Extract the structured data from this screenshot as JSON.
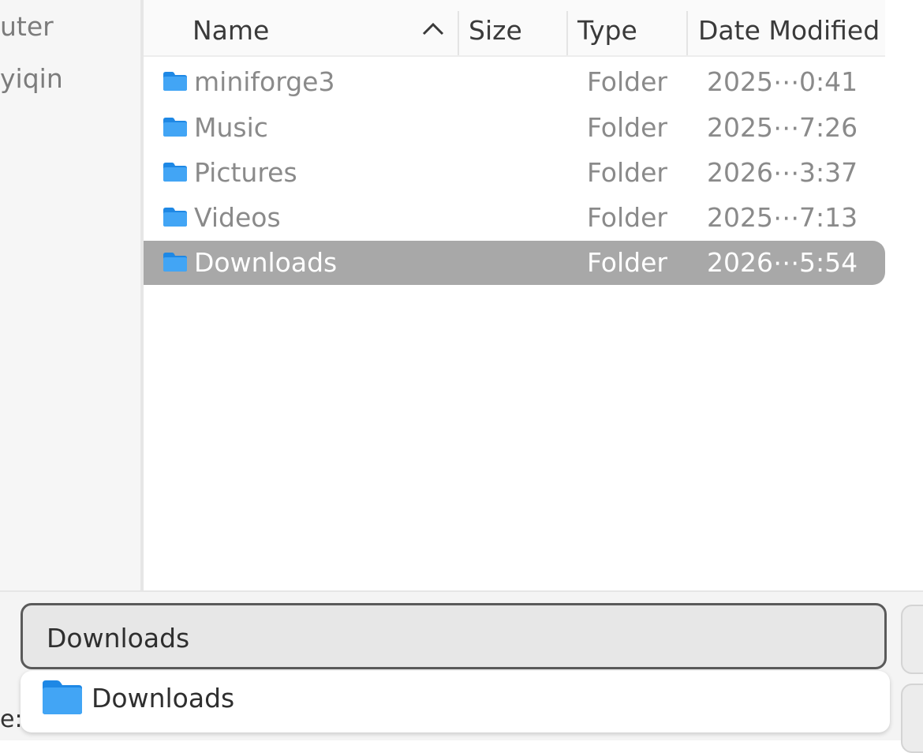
{
  "sidebar": {
    "items": [
      {
        "label": "uter"
      },
      {
        "label": "yiqin"
      }
    ]
  },
  "columns": {
    "name": "Name",
    "size": "Size",
    "type": "Type",
    "date": "Date Modified",
    "sort_icon": "chevron-up-icon"
  },
  "files": [
    {
      "name": "miniforge3",
      "size": "",
      "type": "Folder",
      "date": "2025⋯0:41",
      "icon": "folder-icon",
      "selected": false
    },
    {
      "name": "Music",
      "size": "",
      "type": "Folder",
      "date": "2025⋯7:26",
      "icon": "folder-icon",
      "selected": false
    },
    {
      "name": "Pictures",
      "size": "",
      "type": "Folder",
      "date": "2026⋯3:37",
      "icon": "folder-icon",
      "selected": false
    },
    {
      "name": "Videos",
      "size": "",
      "type": "Folder",
      "date": "2025⋯7:13",
      "icon": "folder-icon",
      "selected": false
    },
    {
      "name": "Downloads",
      "size": "",
      "type": "Folder",
      "date": "2026⋯5:54",
      "icon": "folder-icon",
      "selected": true
    }
  ],
  "filename_input": {
    "value": "Downloads"
  },
  "completion": {
    "label": "Downloads",
    "icon": "folder-icon"
  },
  "bottom_label": "e:",
  "colors": {
    "selection": "#a8a8a8",
    "folder_blue": "#3aa0f0",
    "input_border": "#5a5a5a"
  }
}
